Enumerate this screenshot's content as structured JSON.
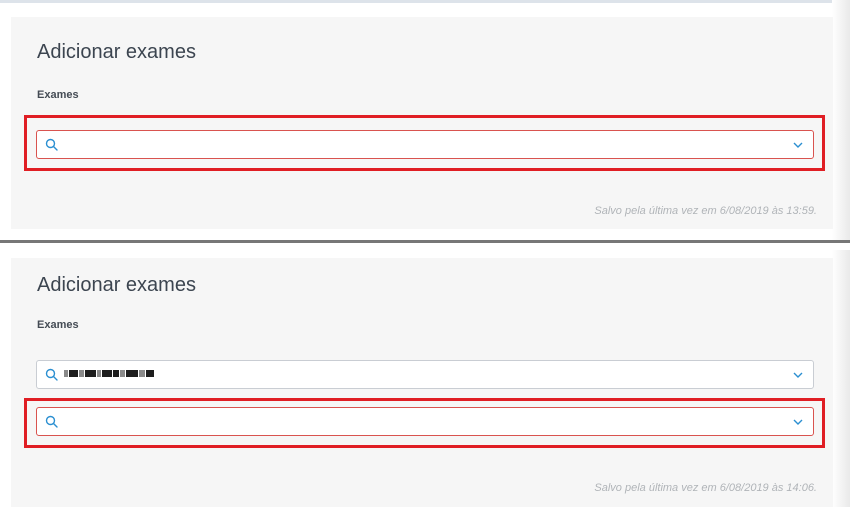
{
  "section_1": {
    "title": "Adicionar exames",
    "field_label": "Exames",
    "saved_note": "Salvo pela última vez em 6/08/2019 às 13:59."
  },
  "section_2": {
    "title": "Adicionar exames",
    "field_label": "Exames",
    "selected_value": "[pixelated text]",
    "saved_note": "Salvo pela última vez em 6/08/2019 às 14:06."
  },
  "colors": {
    "highlight": "#e01e24",
    "icon": "#2b8fd1",
    "panel": "#f6f6f6"
  },
  "icons": [
    "search-icon",
    "chevron-down-icon"
  ]
}
